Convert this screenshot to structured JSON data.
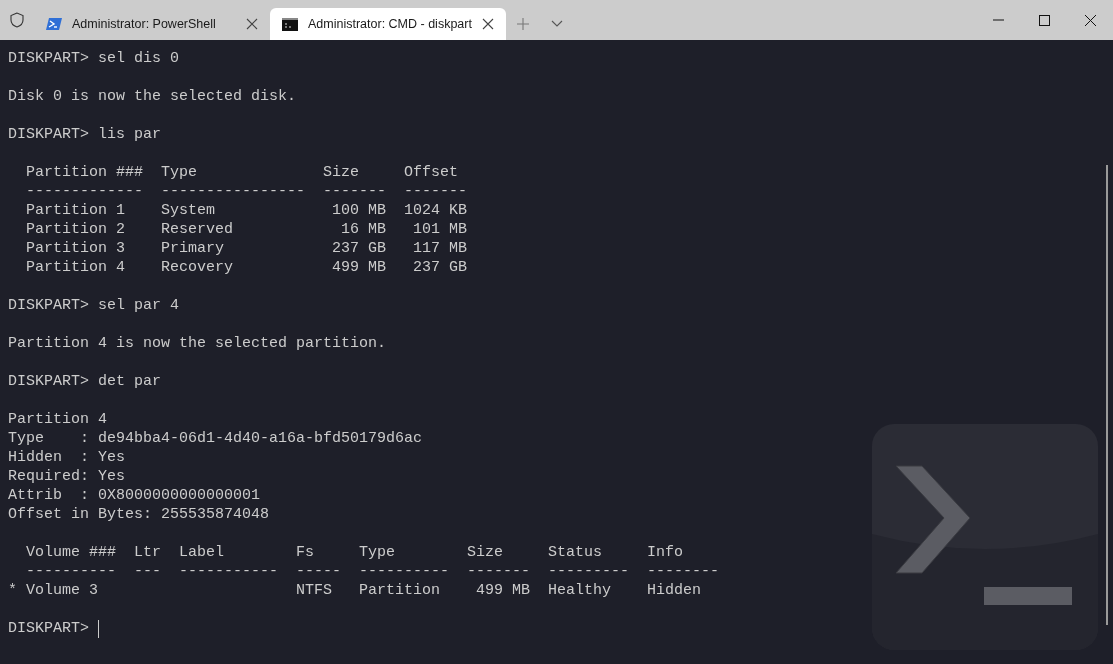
{
  "tabs": [
    {
      "title": "Administrator: PowerShell",
      "kind": "powershell",
      "selected": false
    },
    {
      "title": "Administrator: CMD - diskpart",
      "kind": "cmd",
      "selected": true
    }
  ],
  "terminal": {
    "blocks": [
      [
        "DISKPART> sel dis 0"
      ],
      [
        "Disk 0 is now the selected disk."
      ],
      [
        "DISKPART> lis par"
      ],
      [
        "  Partition ###  Type              Size     Offset",
        "  -------------  ----------------  -------  -------",
        "  Partition 1    System             100 MB  1024 KB",
        "  Partition 2    Reserved            16 MB   101 MB",
        "  Partition 3    Primary            237 GB   117 MB",
        "  Partition 4    Recovery           499 MB   237 GB"
      ],
      [
        "DISKPART> sel par 4"
      ],
      [
        "Partition 4 is now the selected partition."
      ],
      [
        "DISKPART> det par"
      ],
      [
        "Partition 4",
        "Type    : de94bba4-06d1-4d40-a16a-bfd50179d6ac",
        "Hidden  : Yes",
        "Required: Yes",
        "Attrib  : 0X8000000000000001",
        "Offset in Bytes: 255535874048"
      ],
      [
        "  Volume ###  Ltr  Label        Fs     Type        Size     Status     Info",
        "  ----------  ---  -----------  -----  ----------  -------  ---------  --------",
        "* Volume 3                      NTFS   Partition    499 MB  Healthy    Hidden"
      ]
    ],
    "prompt": "DISKPART> "
  }
}
